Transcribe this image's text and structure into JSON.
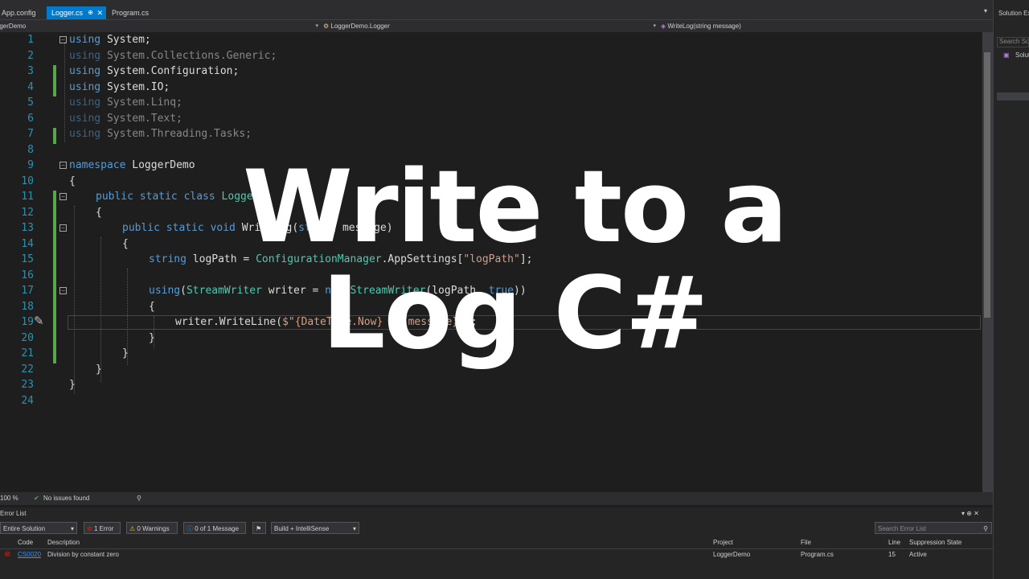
{
  "tabs": {
    "config_label": "App.config",
    "logger_label": "Logger.cs",
    "logger_pin": "⊕",
    "logger_close": "✕",
    "program_label": "Program.cs",
    "dropdown_icon": "▾"
  },
  "navbar": {
    "project": "LoggerDemo",
    "class": "LoggerDemo.Logger",
    "member": "WriteLog(string message)"
  },
  "editor": {
    "line_numbers": [
      "1",
      "2",
      "3",
      "4",
      "5",
      "6",
      "7",
      "8",
      "9",
      "10",
      "11",
      "12",
      "13",
      "14",
      "15",
      "16",
      "17",
      "18",
      "19",
      "20",
      "21",
      "22",
      "23",
      "24"
    ],
    "code": {
      "l1_kw": "using",
      "l1_rest": " System;",
      "l2_kw": "using",
      "l2_rest": " System.Collections.Generic;",
      "l3_kw": "using",
      "l3_rest": " System.Configuration;",
      "l4_kw": "using",
      "l4_rest": " System.IO;",
      "l5_kw": "using",
      "l5_rest": " System.Linq;",
      "l6_kw": "using",
      "l6_rest": " System.Text;",
      "l7_kw": "using",
      "l7_rest": " System.Threading.Tasks;",
      "l9_kw": "namespace",
      "l9_rest": " LoggerDemo",
      "l10": "{",
      "l11_kw": "public static class",
      "l11_ty": " Logger",
      "l12": "{",
      "l13_kw": "public static void",
      "l13_rest": " WriteLog(",
      "l13_kw2": "string",
      "l13_rest2": " message)",
      "l14": "{",
      "l15_kw": "string",
      "l15_rest": " logPath = ",
      "l15_ty": "ConfigurationManager",
      "l15_rest2": ".AppSettings[",
      "l15_str": "\"logPath\"",
      "l15_rest3": "];",
      "l17_kw": "using",
      "l17_rest": "(",
      "l17_ty": "StreamWriter",
      "l17_rest2": " writer = ",
      "l17_kw2": "new",
      "l17_ty2": " StreamWriter",
      "l17_rest3": "(logPath, ",
      "l17_kw3": "true",
      "l17_rest4": "))",
      "l18": "{",
      "l19_rest": "writer.WriteLine(",
      "l19_str": "$\"{DateTime.Now} : {message}\"",
      "l19_rest2": ");",
      "l20": "}",
      "l21": "}",
      "l22": "}",
      "l23": "}"
    },
    "quick_action_icon": "✎"
  },
  "status": {
    "zoom": "100 %",
    "issues_icon": "✔",
    "issues": "No issues found",
    "nav_icon": "⚲"
  },
  "error_list": {
    "title": "Error List",
    "scope": "Entire Solution",
    "errors_btn": "1 Error",
    "warnings_btn": "0 Warnings",
    "messages_btn": "0 of 1 Message",
    "build_filter": "Build + IntelliSense",
    "search_placeholder": "Search Error List",
    "search_icon": "⚲",
    "pin_icons": "▾ ⊕ ✕",
    "columns": {
      "code": "Code",
      "description": "Description",
      "project": "Project",
      "file": "File",
      "line": "Line",
      "suppression": "Suppression State"
    },
    "rows": [
      {
        "code": "CS0020",
        "description": "Division by constant zero",
        "project": "LoggerDemo",
        "file": "Program.cs",
        "line": "15",
        "suppression": "Active"
      }
    ]
  },
  "solution_explorer": {
    "title": "Solution Explorer",
    "search_placeholder": "Search Solution Explorer",
    "root": "Solution"
  },
  "overlay": {
    "line1": "Write to a",
    "line2": "Log C#"
  },
  "colors": {
    "accent": "#007acc",
    "error": "#e51400",
    "keyword": "#569cd6",
    "type": "#4ec9b0",
    "string": "#d69d85",
    "line_number": "#2b91af",
    "changed": "#57a64a"
  }
}
